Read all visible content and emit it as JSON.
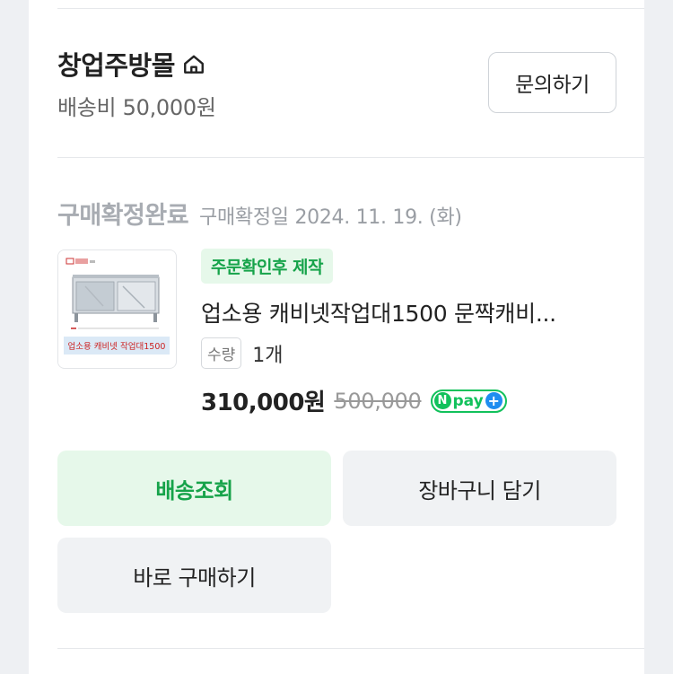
{
  "store": {
    "name": "창업주방몰",
    "shipping_fee": "배송비 50,000원",
    "inquiry_label": "문의하기"
  },
  "order": {
    "status": "구매확정완료",
    "confirmed_date": "구매확정일 2024. 11. 19. (화)"
  },
  "product": {
    "badge": "주문확인후 제작",
    "name": "업소용 캐비넷작업대1500 문짝캐비...",
    "quantity_label": "수량",
    "quantity_value": "1개",
    "price": "310,000원",
    "original_price": "500,000",
    "thumbnail": {
      "caption": "업소용 캐비넷 작업대1500"
    }
  },
  "npay": {
    "n": "N",
    "text": "pay",
    "plus": "+"
  },
  "actions": {
    "track_label": "배송조회",
    "cart_label": "장바구니 담기",
    "buy_label": "바로 구매하기"
  }
}
